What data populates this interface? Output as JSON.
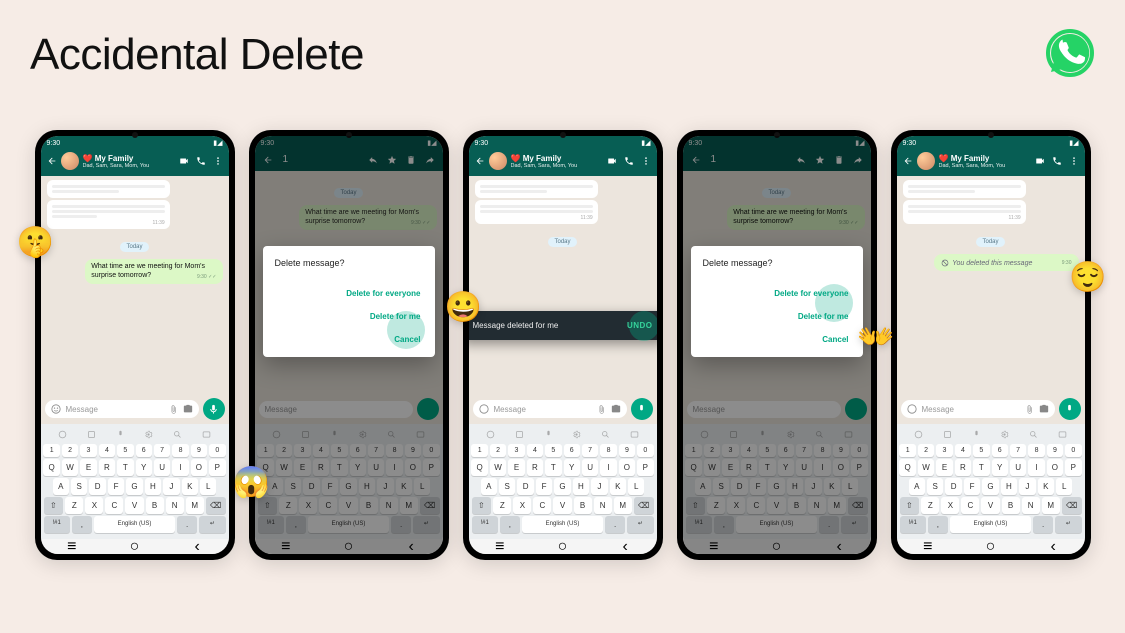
{
  "title": "Accidental Delete",
  "logo_color": "#25d366",
  "statusbar_time": "9:30",
  "chat": {
    "title": "My Family",
    "subtitle": "Dad, Sam, Sara, Mom, You",
    "date_label": "Today",
    "incoming_time": "11:39",
    "outgoing_message": "What time are we meeting for Mom's surprise tomorrow?",
    "outgoing_time": "9:30",
    "deleted_message": "You deleted this message",
    "deleted_time": "9:30"
  },
  "selection": {
    "count": "1"
  },
  "dialog": {
    "title": "Delete message?",
    "delete_everyone": "Delete for everyone",
    "delete_me": "Delete for me",
    "cancel": "Cancel"
  },
  "toast": {
    "text": "Message deleted for me",
    "action": "UNDO"
  },
  "input": {
    "placeholder": "Message"
  },
  "keyboard": {
    "lang": "English (US)",
    "sym": "!#1",
    "row_num": [
      "1",
      "2",
      "3",
      "4",
      "5",
      "6",
      "7",
      "8",
      "9",
      "0"
    ],
    "row1": [
      "Q",
      "W",
      "E",
      "R",
      "T",
      "Y",
      "U",
      "I",
      "O",
      "P"
    ],
    "row2": [
      "A",
      "S",
      "D",
      "F",
      "G",
      "H",
      "J",
      "K",
      "L"
    ],
    "row3": [
      "Z",
      "X",
      "C",
      "V",
      "B",
      "N",
      "M"
    ]
  },
  "emojis": {
    "shush": "🤫",
    "scream": "😱",
    "grin": "😀",
    "wave": "👐",
    "relieved": "😌"
  }
}
